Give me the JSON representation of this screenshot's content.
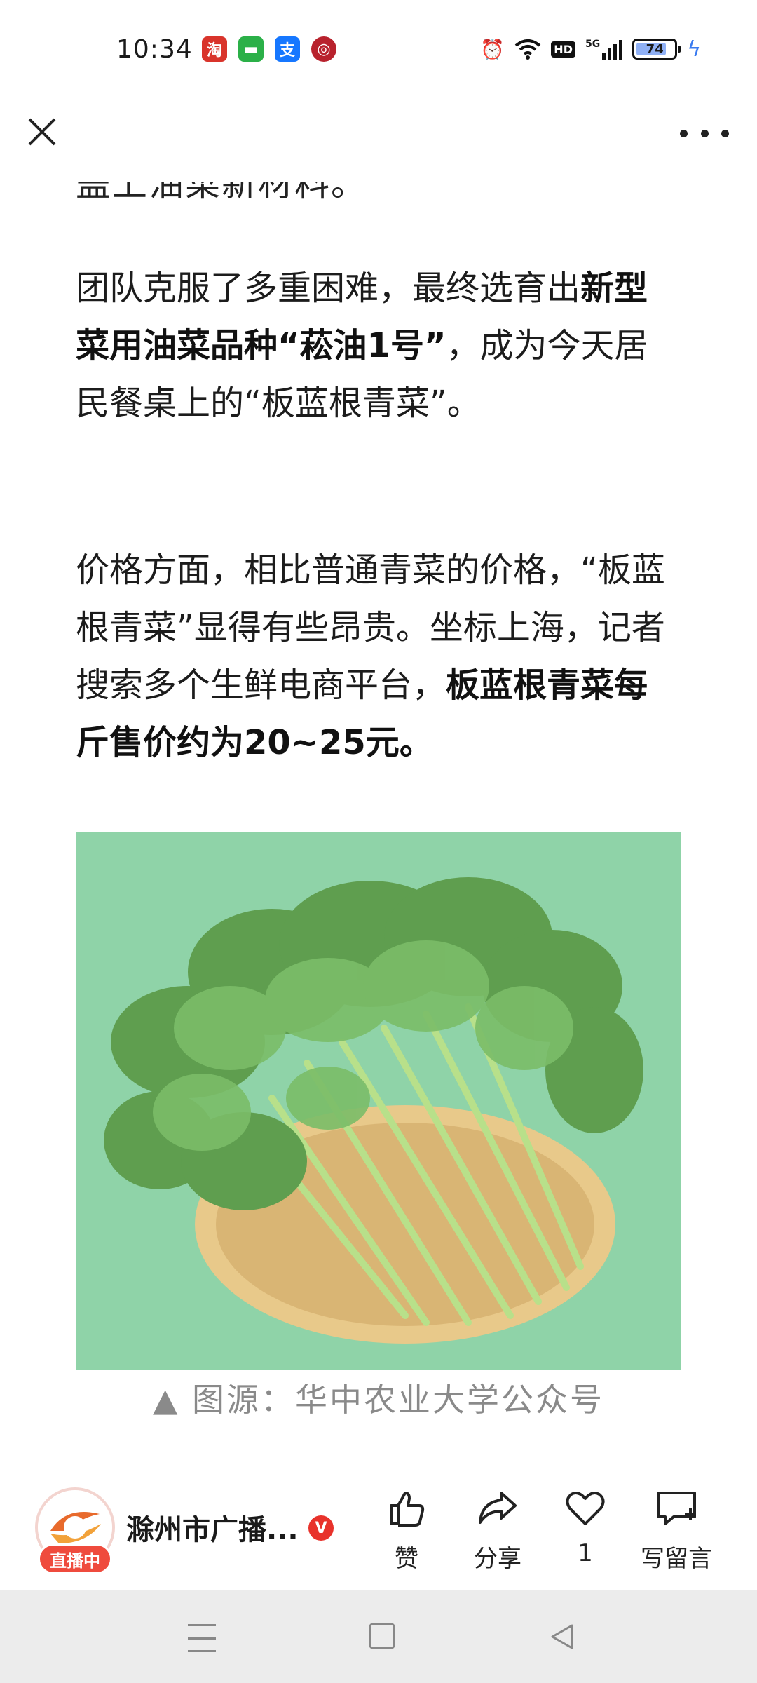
{
  "status_bar": {
    "time": "10:34",
    "apps": [
      {
        "name": "taobao-icon",
        "glyph": "淘"
      },
      {
        "name": "wechat-icon",
        "glyph": "▬"
      },
      {
        "name": "alipay-icon",
        "glyph": "支"
      },
      {
        "name": "bank-icon",
        "glyph": "◎"
      }
    ],
    "hd": "HD",
    "network": "5G",
    "battery": "74"
  },
  "article": {
    "cutoff_line": "盖上油菜新材料。",
    "p1_a": "团队克服了多重困难，最终选育出",
    "p1_bold": "新型菜用油菜品种“菘油1号”",
    "p1_b": "，成为今天居民餐桌上的“板蓝根青菜”。",
    "p2_a": "价格方面，相比普通青菜的价格，“板蓝根青菜”显得有些昂贵。坐标上海，记者搜索多个生鲜电商平台，",
    "p2_bold": "板蓝根青菜每斤售价约为20~25元。",
    "caption": "▲ 图源：华中农业大学公众号"
  },
  "bottom_bar": {
    "author": "滁州市广播...",
    "live_badge": "直播中",
    "verified": "V",
    "like_label": "赞",
    "share_label": "分享",
    "favorite_count": "1",
    "comment_label": "写留言"
  },
  "colors": {
    "accent_red": "#e8322b",
    "photo_background": "#8fd3a8"
  }
}
